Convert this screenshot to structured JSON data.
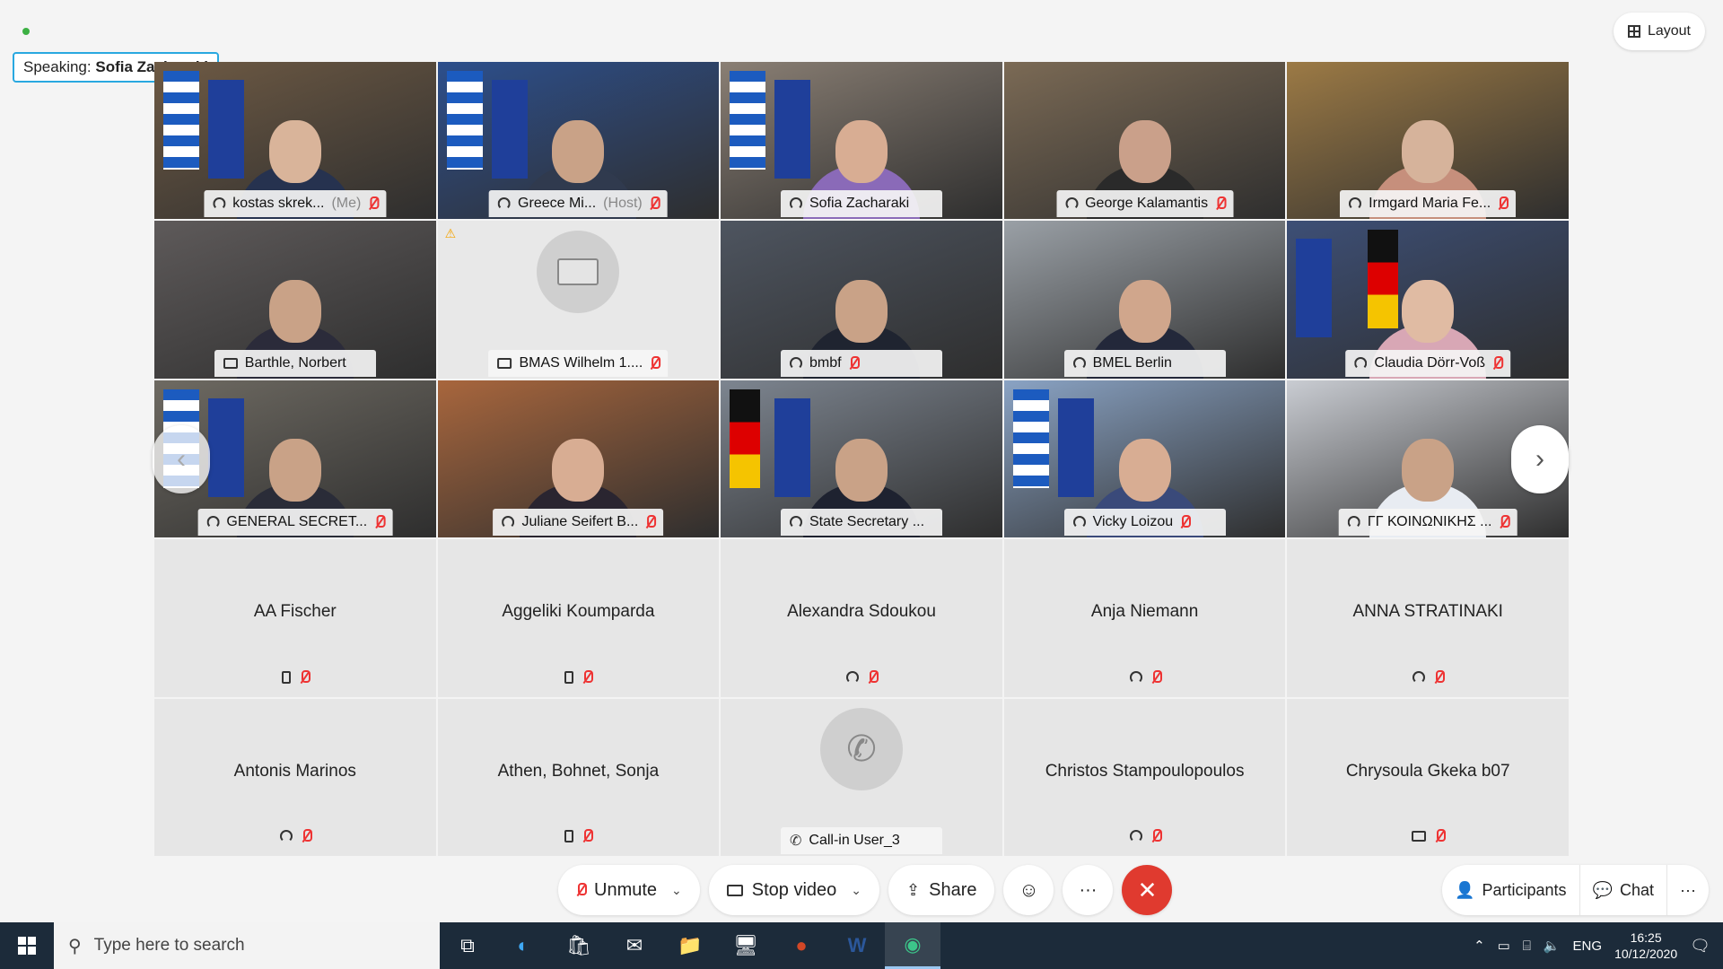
{
  "speaking": {
    "label": "Speaking:",
    "name": "Sofia Zacharaki"
  },
  "layout_label": "Layout",
  "video_tiles": [
    {
      "name": "kostas skrek...",
      "tag": "(Me)",
      "icon": "audio-icon",
      "muted": true,
      "bg": "#6e5a44",
      "skin": "#d9b49a",
      "suit": "#26324f"
    },
    {
      "name": "Greece Mi...",
      "tag": "(Host)",
      "icon": "audio-icon",
      "muted": true,
      "bg": "#2d4f8c",
      "skin": "#c9a287",
      "suit": "#303a4e"
    },
    {
      "name": "Sofia Zacharaki",
      "tag": "",
      "icon": "audio-icon",
      "muted": false,
      "bg": "#8a7f74",
      "skin": "#d8ad93",
      "suit": "#8a6ab8",
      "active": true
    },
    {
      "name": "George Kalamantis",
      "tag": "",
      "icon": "audio-icon",
      "muted": true,
      "bg": "#7b6a55",
      "skin": "#caa08a",
      "suit": "#2a2a2a"
    },
    {
      "name": "Irmgard Maria Fe...",
      "tag": "",
      "icon": "audio-icon",
      "muted": true,
      "bg": "#9c7a45",
      "skin": "#d6b39b",
      "suit": "#c68f7c"
    },
    {
      "name": "Barthle, Norbert",
      "tag": "",
      "icon": "screen-icon",
      "muted": false,
      "bg": "#5e5a5a",
      "skin": "#c9a287",
      "suit": "#2b2b3a"
    },
    {
      "name": "BMAS Wilhelm 1....",
      "tag": "",
      "icon": "screen-icon",
      "muted": true,
      "placeholder": true
    },
    {
      "name": "bmbf",
      "tag": "",
      "icon": "audio-icon",
      "muted": true,
      "bg": "#4e5560",
      "skin": "#c9a287",
      "suit": "#1f2430"
    },
    {
      "name": "BMEL Berlin",
      "tag": "",
      "icon": "audio-icon",
      "muted": false,
      "bg": "#9aa0a6",
      "skin": "#d0a68c",
      "suit": "#23283a"
    },
    {
      "name": "Claudia Dörr-Voß",
      "tag": "",
      "icon": "audio-icon",
      "muted": true,
      "bg": "#3d4f76",
      "skin": "#e0bba3",
      "suit": "#d8a7b5"
    },
    {
      "name": "GENERAL SECRET...",
      "tag": "",
      "icon": "audio-icon",
      "muted": true,
      "bg": "#6e6a62",
      "skin": "#c9a287",
      "suit": "#2a2c38"
    },
    {
      "name": "Juliane Seifert B...",
      "tag": "",
      "icon": "audio-icon",
      "muted": true,
      "bg": "#a8663d",
      "skin": "#d8ad93",
      "suit": "#2a2530"
    },
    {
      "name": "State Secretary ...",
      "tag": "",
      "icon": "audio-icon",
      "muted": false,
      "bg": "#7d8590",
      "skin": "#c9a287",
      "suit": "#1e2230"
    },
    {
      "name": "Vicky Loizou",
      "tag": "",
      "icon": "audio-icon",
      "muted": true,
      "bg": "#8aa3c4",
      "skin": "#d8ad93",
      "suit": "#3a4a7a"
    },
    {
      "name": "ΓΓ ΚΟΙΝΩΝΙΚΗΣ ...",
      "tag": "",
      "icon": "audio-icon",
      "muted": true,
      "bg": "#c9ccd2",
      "skin": "#c9a287",
      "suit": "#e8ecf2"
    }
  ],
  "audio_tiles": [
    {
      "name": "AA Fischer",
      "icon": "phone-icon",
      "muted": true
    },
    {
      "name": "Aggeliki Koumparda",
      "icon": "phone-icon",
      "muted": true
    },
    {
      "name": "Alexandra Sdoukou",
      "icon": "audio-icon",
      "muted": true
    },
    {
      "name": "Anja Niemann",
      "icon": "audio-icon",
      "muted": true
    },
    {
      "name": "ANNA STRATINAKI",
      "icon": "audio-icon",
      "muted": true
    },
    {
      "name": "Antonis Marinos",
      "icon": "audio-icon",
      "muted": true
    },
    {
      "name": "Athen, Bohnet, Sonja",
      "icon": "phone-icon",
      "muted": true
    },
    {
      "name": "Call-in User_3",
      "icon": "handset-icon",
      "muted": false,
      "callin": true
    },
    {
      "name": "Christos Stampoulopoulos",
      "icon": "audio-icon",
      "muted": true
    },
    {
      "name": "Chrysoula Gkeka b07",
      "icon": "screen-icon",
      "muted": true
    }
  ],
  "controls": {
    "unmute": "Unmute",
    "stop_video": "Stop video",
    "share": "Share"
  },
  "right_controls": {
    "participants": "Participants",
    "chat": "Chat"
  },
  "taskbar": {
    "search_placeholder": "Type here to search",
    "lang": "ENG",
    "time": "16:25",
    "date": "10/12/2020"
  },
  "colors": {
    "accent": "#29a8e0",
    "end_call": "#e03a2f",
    "taskbar": "#1c2b3a"
  }
}
